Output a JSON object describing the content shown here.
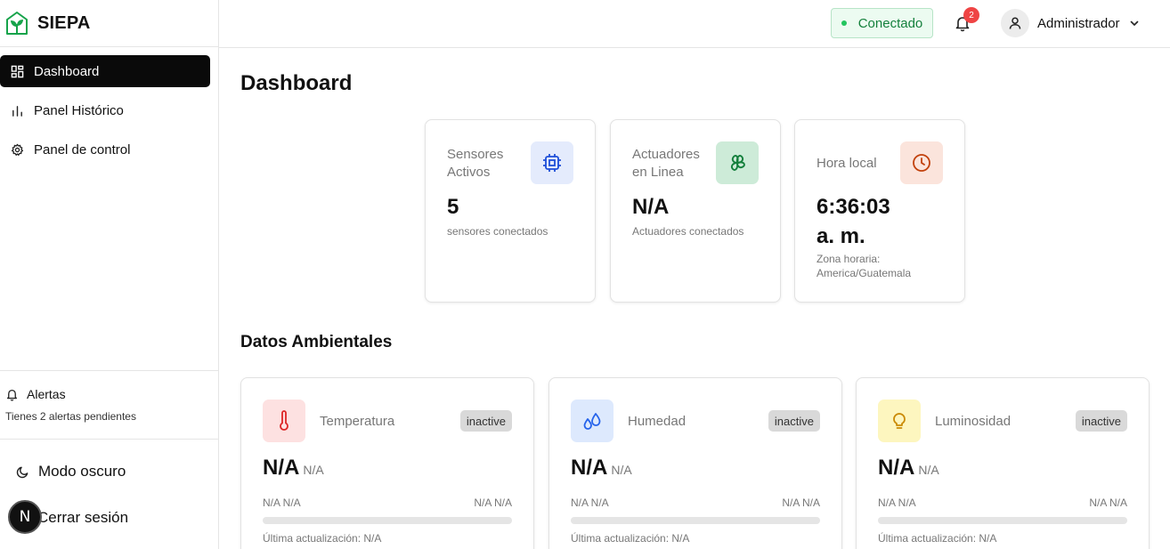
{
  "app": {
    "name": "SIEPA"
  },
  "sidebar": {
    "items": [
      {
        "label": "Dashboard",
        "icon": "dashboard-grid-icon",
        "active": true
      },
      {
        "label": "Panel Histórico",
        "icon": "bar-chart-icon",
        "active": false
      },
      {
        "label": "Panel de control",
        "icon": "gear-icon",
        "active": false
      }
    ],
    "alerts": {
      "title": "Alertas",
      "subtitle": "Tienes 2 alertas pendientes"
    },
    "dark_mode_label": "Modo oscuro",
    "logout_label": "Cerrar sesión",
    "next_badge": "N"
  },
  "header": {
    "status": "Conectado",
    "notification_count": "2",
    "user_name": "Administrador"
  },
  "main": {
    "title": "Dashboard",
    "stats": [
      {
        "label_line1": "Sensores",
        "label_line2": "Activos",
        "value": "5",
        "sub_line1": "sensores conectados",
        "sub_line2": "",
        "icon": "chip-icon",
        "icon_bg": "#e4ebfc",
        "icon_color": "#1d4ed8"
      },
      {
        "label_line1": "Actuadores",
        "label_line2": "en Linea",
        "value": "N/A",
        "sub_line1": "Actuadores conectados",
        "sub_line2": "",
        "icon": "fan-icon",
        "icon_bg": "#cdebd8",
        "icon_color": "#15803d"
      },
      {
        "label_line1": "Hora local",
        "label_line2": "",
        "value_line1": "6:36:03",
        "value_line2": "a. m.",
        "sub_line1": "Zona horaria:",
        "sub_line2": "America/Guatemala",
        "icon": "clock-icon",
        "icon_bg": "#fbe4dc",
        "icon_color": "#c2410c"
      }
    ],
    "env_title": "Datos Ambientales",
    "env_cards": [
      {
        "name": "Temperatura",
        "badge": "inactive",
        "value": "N/A",
        "unit": "N/A",
        "min": "N/A N/A",
        "max": "N/A N/A",
        "updated": "Última actualización: N/A",
        "icon": "thermometer-icon",
        "icon_bg": "#fde1e1",
        "icon_color": "#dc2626"
      },
      {
        "name": "Humedad",
        "badge": "inactive",
        "value": "N/A",
        "unit": "N/A",
        "min": "N/A N/A",
        "max": "N/A N/A",
        "updated": "Última actualización: N/A",
        "icon": "droplets-icon",
        "icon_bg": "#dde9fd",
        "icon_color": "#2563eb"
      },
      {
        "name": "Luminosidad",
        "badge": "inactive",
        "value": "N/A",
        "unit": "N/A",
        "min": "N/A N/A",
        "max": "N/A N/A",
        "updated": "Última actualización: N/A",
        "icon": "lightbulb-icon",
        "icon_bg": "#fdf6bf",
        "icon_color": "#ca8a04"
      }
    ]
  }
}
